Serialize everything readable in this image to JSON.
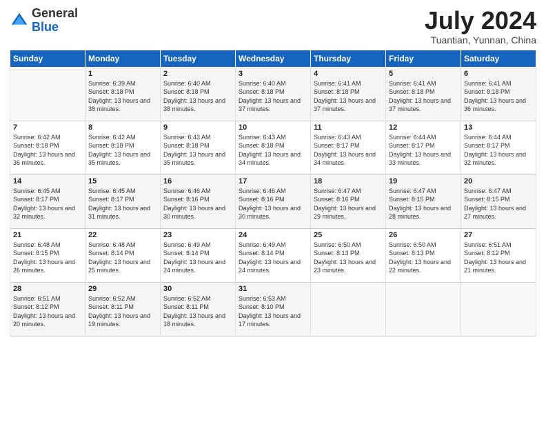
{
  "logo": {
    "general": "General",
    "blue": "Blue"
  },
  "header": {
    "month": "July 2024",
    "location": "Tuantian, Yunnan, China"
  },
  "days_of_week": [
    "Sunday",
    "Monday",
    "Tuesday",
    "Wednesday",
    "Thursday",
    "Friday",
    "Saturday"
  ],
  "weeks": [
    [
      {
        "day": "",
        "info": ""
      },
      {
        "day": "1",
        "info": "Sunrise: 6:39 AM\nSunset: 8:18 PM\nDaylight: 13 hours and 38 minutes."
      },
      {
        "day": "2",
        "info": "Sunrise: 6:40 AM\nSunset: 8:18 PM\nDaylight: 13 hours and 38 minutes."
      },
      {
        "day": "3",
        "info": "Sunrise: 6:40 AM\nSunset: 8:18 PM\nDaylight: 13 hours and 37 minutes."
      },
      {
        "day": "4",
        "info": "Sunrise: 6:41 AM\nSunset: 8:18 PM\nDaylight: 13 hours and 37 minutes."
      },
      {
        "day": "5",
        "info": "Sunrise: 6:41 AM\nSunset: 8:18 PM\nDaylight: 13 hours and 37 minutes."
      },
      {
        "day": "6",
        "info": "Sunrise: 6:41 AM\nSunset: 8:18 PM\nDaylight: 13 hours and 36 minutes."
      }
    ],
    [
      {
        "day": "7",
        "info": "Sunrise: 6:42 AM\nSunset: 8:18 PM\nDaylight: 13 hours and 36 minutes."
      },
      {
        "day": "8",
        "info": "Sunrise: 6:42 AM\nSunset: 8:18 PM\nDaylight: 13 hours and 35 minutes."
      },
      {
        "day": "9",
        "info": "Sunrise: 6:43 AM\nSunset: 8:18 PM\nDaylight: 13 hours and 35 minutes."
      },
      {
        "day": "10",
        "info": "Sunrise: 6:43 AM\nSunset: 8:18 PM\nDaylight: 13 hours and 34 minutes."
      },
      {
        "day": "11",
        "info": "Sunrise: 6:43 AM\nSunset: 8:17 PM\nDaylight: 13 hours and 34 minutes."
      },
      {
        "day": "12",
        "info": "Sunrise: 6:44 AM\nSunset: 8:17 PM\nDaylight: 13 hours and 33 minutes."
      },
      {
        "day": "13",
        "info": "Sunrise: 6:44 AM\nSunset: 8:17 PM\nDaylight: 13 hours and 32 minutes."
      }
    ],
    [
      {
        "day": "14",
        "info": "Sunrise: 6:45 AM\nSunset: 8:17 PM\nDaylight: 13 hours and 32 minutes."
      },
      {
        "day": "15",
        "info": "Sunrise: 6:45 AM\nSunset: 8:17 PM\nDaylight: 13 hours and 31 minutes."
      },
      {
        "day": "16",
        "info": "Sunrise: 6:46 AM\nSunset: 8:16 PM\nDaylight: 13 hours and 30 minutes."
      },
      {
        "day": "17",
        "info": "Sunrise: 6:46 AM\nSunset: 8:16 PM\nDaylight: 13 hours and 30 minutes."
      },
      {
        "day": "18",
        "info": "Sunrise: 6:47 AM\nSunset: 8:16 PM\nDaylight: 13 hours and 29 minutes."
      },
      {
        "day": "19",
        "info": "Sunrise: 6:47 AM\nSunset: 8:15 PM\nDaylight: 13 hours and 28 minutes."
      },
      {
        "day": "20",
        "info": "Sunrise: 6:47 AM\nSunset: 8:15 PM\nDaylight: 13 hours and 27 minutes."
      }
    ],
    [
      {
        "day": "21",
        "info": "Sunrise: 6:48 AM\nSunset: 8:15 PM\nDaylight: 13 hours and 26 minutes."
      },
      {
        "day": "22",
        "info": "Sunrise: 6:48 AM\nSunset: 8:14 PM\nDaylight: 13 hours and 25 minutes."
      },
      {
        "day": "23",
        "info": "Sunrise: 6:49 AM\nSunset: 8:14 PM\nDaylight: 13 hours and 24 minutes."
      },
      {
        "day": "24",
        "info": "Sunrise: 6:49 AM\nSunset: 8:14 PM\nDaylight: 13 hours and 24 minutes."
      },
      {
        "day": "25",
        "info": "Sunrise: 6:50 AM\nSunset: 8:13 PM\nDaylight: 13 hours and 23 minutes."
      },
      {
        "day": "26",
        "info": "Sunrise: 6:50 AM\nSunset: 8:13 PM\nDaylight: 13 hours and 22 minutes."
      },
      {
        "day": "27",
        "info": "Sunrise: 6:51 AM\nSunset: 8:12 PM\nDaylight: 13 hours and 21 minutes."
      }
    ],
    [
      {
        "day": "28",
        "info": "Sunrise: 6:51 AM\nSunset: 8:12 PM\nDaylight: 13 hours and 20 minutes."
      },
      {
        "day": "29",
        "info": "Sunrise: 6:52 AM\nSunset: 8:11 PM\nDaylight: 13 hours and 19 minutes."
      },
      {
        "day": "30",
        "info": "Sunrise: 6:52 AM\nSunset: 8:11 PM\nDaylight: 13 hours and 18 minutes."
      },
      {
        "day": "31",
        "info": "Sunrise: 6:53 AM\nSunset: 8:10 PM\nDaylight: 13 hours and 17 minutes."
      },
      {
        "day": "",
        "info": ""
      },
      {
        "day": "",
        "info": ""
      },
      {
        "day": "",
        "info": ""
      }
    ]
  ]
}
